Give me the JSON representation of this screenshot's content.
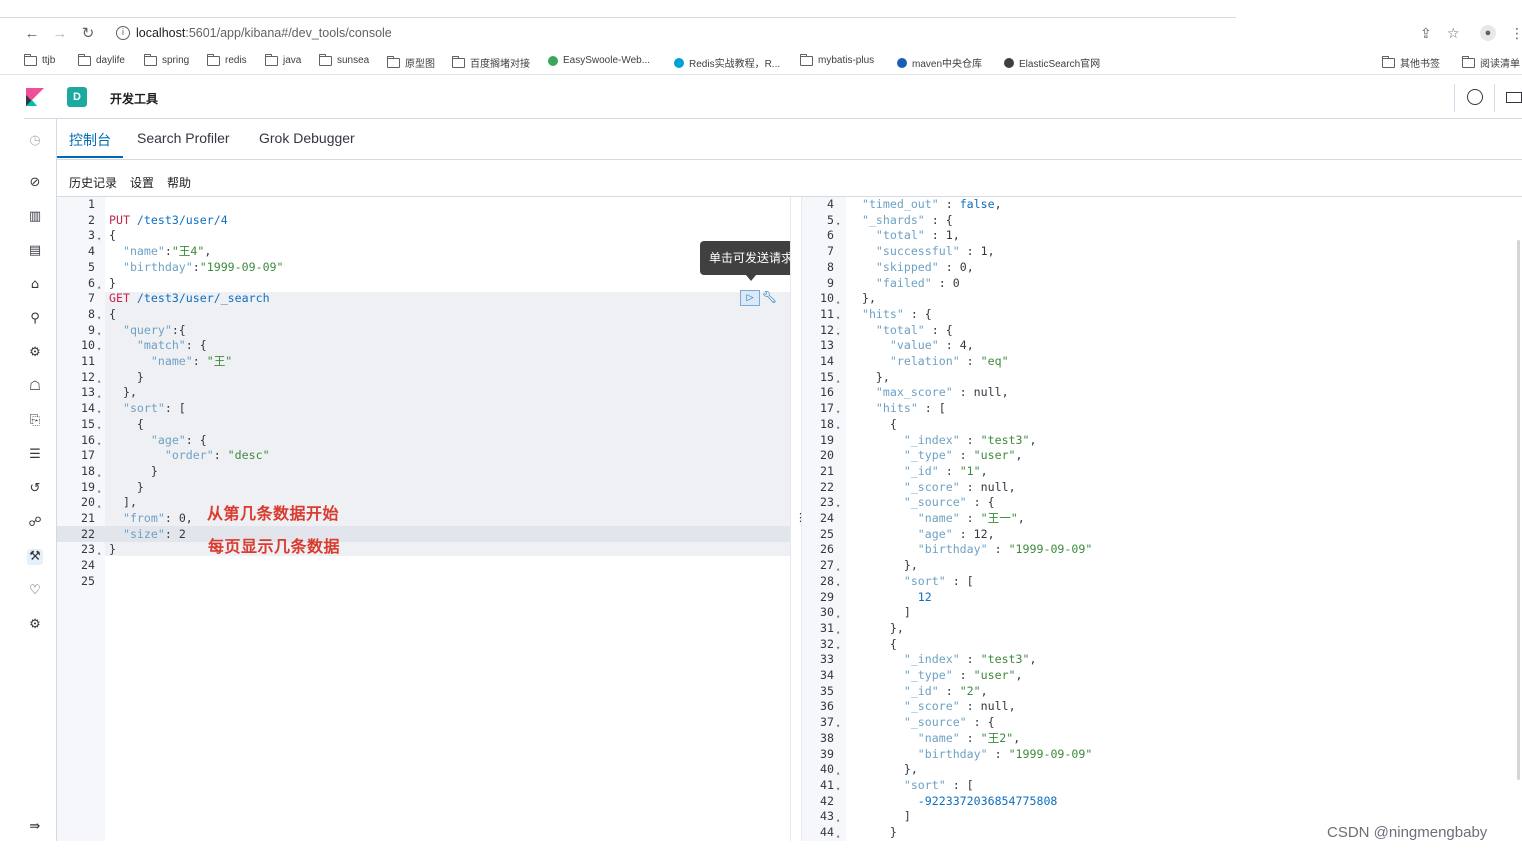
{
  "browser": {
    "url_host": "localhost",
    "url_rest": ":5601/app/kibana#/dev_tools/console",
    "bookmarks": [
      "ttjb",
      "daylife",
      "spring",
      "redis",
      "java",
      "sunsea",
      "原型图",
      "百度搁堵对接",
      "EasySwoole-Web...",
      "Redis实战教程，R...",
      "mybatis-plus",
      "maven中央仓库",
      "ElasticSearch官网",
      "其他书签",
      "阅读清单"
    ]
  },
  "header": {
    "space_letter": "D",
    "breadcrumb": "开发工具"
  },
  "tabs": [
    "控制台",
    "Search Profiler",
    "Grok Debugger"
  ],
  "submenu": [
    "历史记录",
    "设置",
    "帮助"
  ],
  "tooltip": "单击可发送请求",
  "annotations": {
    "from_note": "从第几条数据开始",
    "size_note": "每页显示几条数据"
  },
  "watermark": "CSDN @ningmengbaby",
  "left_lines": [
    {
      "n": "1",
      "t": []
    },
    {
      "n": "2",
      "t": [
        [
          "m",
          "PUT"
        ],
        [
          "b",
          " /test3/user/4"
        ]
      ]
    },
    {
      "n": "3",
      "f": 1,
      "t": [
        [
          "p",
          "{"
        ]
      ]
    },
    {
      "n": "4",
      "t": [
        [
          "k",
          "  \"name\""
        ],
        [
          "p",
          ":"
        ],
        [
          "s",
          "\"王4\""
        ],
        [
          "p",
          ","
        ]
      ]
    },
    {
      "n": "5",
      "t": [
        [
          "k",
          "  \"birthday\""
        ],
        [
          "p",
          ":"
        ],
        [
          "s",
          "\"1999-09-09\""
        ]
      ]
    },
    {
      "n": "6",
      "f": 2,
      "t": [
        [
          "p",
          "}"
        ]
      ]
    },
    {
      "n": "7",
      "t": [
        [
          "m",
          "GET"
        ],
        [
          "b",
          " /test3/user/_search"
        ]
      ]
    },
    {
      "n": "8",
      "f": 1,
      "t": [
        [
          "p",
          "{"
        ]
      ]
    },
    {
      "n": "9",
      "f": 1,
      "t": [
        [
          "k",
          "  \"query\""
        ],
        [
          "p",
          ":{"
        ]
      ]
    },
    {
      "n": "10",
      "f": 1,
      "t": [
        [
          "k",
          "    \"match\""
        ],
        [
          "p",
          ": {"
        ]
      ]
    },
    {
      "n": "11",
      "t": [
        [
          "k",
          "      \"name\""
        ],
        [
          "p",
          ": "
        ],
        [
          "s",
          "\"王\""
        ]
      ]
    },
    {
      "n": "12",
      "f": 2,
      "t": [
        [
          "p",
          "    }"
        ]
      ]
    },
    {
      "n": "13",
      "f": 2,
      "t": [
        [
          "p",
          "  },"
        ]
      ]
    },
    {
      "n": "14",
      "f": 1,
      "t": [
        [
          "k",
          "  \"sort\""
        ],
        [
          "p",
          ": ["
        ]
      ]
    },
    {
      "n": "15",
      "f": 1,
      "t": [
        [
          "p",
          "    {"
        ]
      ]
    },
    {
      "n": "16",
      "f": 1,
      "t": [
        [
          "k",
          "      \"age\""
        ],
        [
          "p",
          ": {"
        ]
      ]
    },
    {
      "n": "17",
      "t": [
        [
          "k",
          "        \"order\""
        ],
        [
          "p",
          ": "
        ],
        [
          "s",
          "\"desc\""
        ]
      ]
    },
    {
      "n": "18",
      "f": 2,
      "t": [
        [
          "p",
          "      }"
        ]
      ]
    },
    {
      "n": "19",
      "f": 2,
      "t": [
        [
          "p",
          "    }"
        ]
      ]
    },
    {
      "n": "20",
      "f": 2,
      "t": [
        [
          "p",
          "  ],"
        ]
      ]
    },
    {
      "n": "21",
      "t": [
        [
          "k",
          "  \"from\""
        ],
        [
          "p",
          ": "
        ],
        [
          "n",
          "0"
        ],
        [
          "p",
          ","
        ]
      ]
    },
    {
      "n": "22",
      "t": [
        [
          "k",
          "  \"size\""
        ],
        [
          "p",
          ": "
        ],
        [
          "n",
          "2"
        ]
      ]
    },
    {
      "n": "23",
      "f": 2,
      "t": [
        [
          "p",
          "}"
        ]
      ]
    },
    {
      "n": "24",
      "t": []
    },
    {
      "n": "25",
      "t": []
    }
  ],
  "right_lines": [
    {
      "n": "4",
      "t": [
        [
          "k",
          "  \"timed_out\""
        ],
        [
          "p",
          " : "
        ],
        [
          "b",
          "false"
        ],
        [
          "p",
          ","
        ]
      ]
    },
    {
      "n": "5",
      "f": 1,
      "t": [
        [
          "k",
          "  \"_shards\""
        ],
        [
          "p",
          " : {"
        ]
      ]
    },
    {
      "n": "6",
      "t": [
        [
          "k",
          "    \"total\""
        ],
        [
          "p",
          " : "
        ],
        [
          "n",
          "1"
        ],
        [
          "p",
          ","
        ]
      ]
    },
    {
      "n": "7",
      "t": [
        [
          "k",
          "    \"successful\""
        ],
        [
          "p",
          " : "
        ],
        [
          "n",
          "1"
        ],
        [
          "p",
          ","
        ]
      ]
    },
    {
      "n": "8",
      "t": [
        [
          "k",
          "    \"skipped\""
        ],
        [
          "p",
          " : "
        ],
        [
          "n",
          "0"
        ],
        [
          "p",
          ","
        ]
      ]
    },
    {
      "n": "9",
      "t": [
        [
          "k",
          "    \"failed\""
        ],
        [
          "p",
          " : "
        ],
        [
          "n",
          "0"
        ]
      ]
    },
    {
      "n": "10",
      "f": 2,
      "t": [
        [
          "p",
          "  },"
        ]
      ]
    },
    {
      "n": "11",
      "f": 1,
      "t": [
        [
          "k",
          "  \"hits\""
        ],
        [
          "p",
          " : {"
        ]
      ]
    },
    {
      "n": "12",
      "f": 1,
      "t": [
        [
          "k",
          "    \"total\""
        ],
        [
          "p",
          " : {"
        ]
      ]
    },
    {
      "n": "13",
      "t": [
        [
          "k",
          "      \"value\""
        ],
        [
          "p",
          " : "
        ],
        [
          "n",
          "4"
        ],
        [
          "p",
          ","
        ]
      ]
    },
    {
      "n": "14",
      "t": [
        [
          "k",
          "      \"relation\""
        ],
        [
          "p",
          " : "
        ],
        [
          "s",
          "\"eq\""
        ]
      ]
    },
    {
      "n": "15",
      "f": 2,
      "t": [
        [
          "p",
          "    },"
        ]
      ]
    },
    {
      "n": "16",
      "t": [
        [
          "k",
          "    \"max_score\""
        ],
        [
          "p",
          " : "
        ],
        [
          "p",
          "null"
        ],
        [
          "p",
          ","
        ]
      ]
    },
    {
      "n": "17",
      "f": 1,
      "t": [
        [
          "k",
          "    \"hits\""
        ],
        [
          "p",
          " : ["
        ]
      ]
    },
    {
      "n": "18",
      "f": 1,
      "t": [
        [
          "p",
          "      {"
        ]
      ]
    },
    {
      "n": "19",
      "t": [
        [
          "k",
          "        \"_index\""
        ],
        [
          "p",
          " : "
        ],
        [
          "s",
          "\"test3\""
        ],
        [
          "p",
          ","
        ]
      ]
    },
    {
      "n": "20",
      "t": [
        [
          "k",
          "        \"_type\""
        ],
        [
          "p",
          " : "
        ],
        [
          "s",
          "\"user\""
        ],
        [
          "p",
          ","
        ]
      ]
    },
    {
      "n": "21",
      "t": [
        [
          "k",
          "        \"_id\""
        ],
        [
          "p",
          " : "
        ],
        [
          "s",
          "\"1\""
        ],
        [
          "p",
          ","
        ]
      ]
    },
    {
      "n": "22",
      "t": [
        [
          "k",
          "        \"_score\""
        ],
        [
          "p",
          " : "
        ],
        [
          "p",
          "null"
        ],
        [
          "p",
          ","
        ]
      ]
    },
    {
      "n": "23",
      "f": 1,
      "t": [
        [
          "k",
          "        \"_source\""
        ],
        [
          "p",
          " : {"
        ]
      ]
    },
    {
      "n": "24",
      "t": [
        [
          "k",
          "          \"name\""
        ],
        [
          "p",
          " : "
        ],
        [
          "s",
          "\"王一\""
        ],
        [
          "p",
          ","
        ]
      ]
    },
    {
      "n": "25",
      "t": [
        [
          "k",
          "          \"age\""
        ],
        [
          "p",
          " : "
        ],
        [
          "n",
          "12"
        ],
        [
          "p",
          ","
        ]
      ]
    },
    {
      "n": "26",
      "t": [
        [
          "k",
          "          \"birthday\""
        ],
        [
          "p",
          " : "
        ],
        [
          "s",
          "\"1999-09-09\""
        ]
      ]
    },
    {
      "n": "27",
      "f": 2,
      "t": [
        [
          "p",
          "        },"
        ]
      ]
    },
    {
      "n": "28",
      "f": 1,
      "t": [
        [
          "k",
          "        \"sort\""
        ],
        [
          "p",
          " : ["
        ]
      ]
    },
    {
      "n": "29",
      "t": [
        [
          "b",
          "          12"
        ]
      ]
    },
    {
      "n": "30",
      "f": 2,
      "t": [
        [
          "p",
          "        ]"
        ]
      ]
    },
    {
      "n": "31",
      "f": 2,
      "t": [
        [
          "p",
          "      },"
        ]
      ]
    },
    {
      "n": "32",
      "f": 1,
      "t": [
        [
          "p",
          "      {"
        ]
      ]
    },
    {
      "n": "33",
      "t": [
        [
          "k",
          "        \"_index\""
        ],
        [
          "p",
          " : "
        ],
        [
          "s",
          "\"test3\""
        ],
        [
          "p",
          ","
        ]
      ]
    },
    {
      "n": "34",
      "t": [
        [
          "k",
          "        \"_type\""
        ],
        [
          "p",
          " : "
        ],
        [
          "s",
          "\"user\""
        ],
        [
          "p",
          ","
        ]
      ]
    },
    {
      "n": "35",
      "t": [
        [
          "k",
          "        \"_id\""
        ],
        [
          "p",
          " : "
        ],
        [
          "s",
          "\"2\""
        ],
        [
          "p",
          ","
        ]
      ]
    },
    {
      "n": "36",
      "t": [
        [
          "k",
          "        \"_score\""
        ],
        [
          "p",
          " : "
        ],
        [
          "p",
          "null"
        ],
        [
          "p",
          ","
        ]
      ]
    },
    {
      "n": "37",
      "f": 1,
      "t": [
        [
          "k",
          "        \"_source\""
        ],
        [
          "p",
          " : {"
        ]
      ]
    },
    {
      "n": "38",
      "t": [
        [
          "k",
          "          \"name\""
        ],
        [
          "p",
          " : "
        ],
        [
          "s",
          "\"王2\""
        ],
        [
          "p",
          ","
        ]
      ]
    },
    {
      "n": "39",
      "t": [
        [
          "k",
          "          \"birthday\""
        ],
        [
          "p",
          " : "
        ],
        [
          "s",
          "\"1999-09-09\""
        ]
      ]
    },
    {
      "n": "40",
      "f": 2,
      "t": [
        [
          "p",
          "        },"
        ]
      ]
    },
    {
      "n": "41",
      "f": 1,
      "t": [
        [
          "k",
          "        \"sort\""
        ],
        [
          "p",
          " : ["
        ]
      ]
    },
    {
      "n": "42",
      "t": [
        [
          "b",
          "          -9223372036854775808"
        ]
      ]
    },
    {
      "n": "43",
      "f": 2,
      "t": [
        [
          "p",
          "        ]"
        ]
      ]
    },
    {
      "n": "44",
      "f": 2,
      "t": [
        [
          "p",
          "      }"
        ]
      ]
    }
  ],
  "colors": {
    "accent": "#006bb4",
    "annotation": "#d93b2f",
    "space_badge": "#1ba9a0"
  }
}
